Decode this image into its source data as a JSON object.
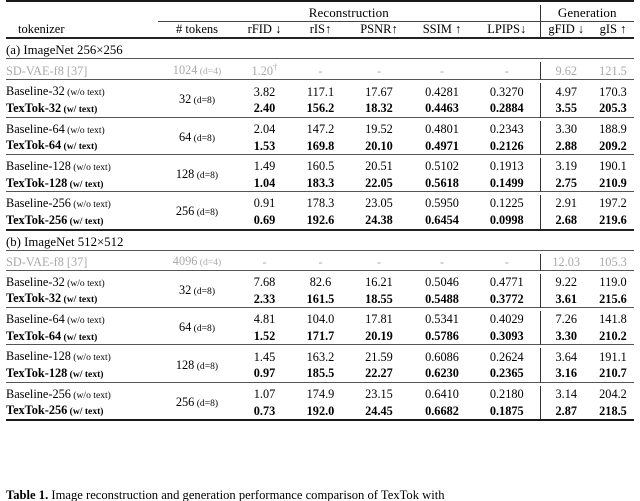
{
  "table": {
    "group_headers": [
      {
        "label": "Reconstruction",
        "span": 6
      },
      {
        "label": "Generation",
        "span": 2
      }
    ],
    "columns": [
      {
        "key": "tokenizer",
        "label": "tokenizer"
      },
      {
        "key": "tokens",
        "label": "# tokens"
      },
      {
        "key": "rfid",
        "label": "rFID ↓"
      },
      {
        "key": "ris",
        "label": "rIS↑"
      },
      {
        "key": "psnr",
        "label": "PSNR↑"
      },
      {
        "key": "ssim",
        "label": "SSIM ↑"
      },
      {
        "key": "lpips",
        "label": "LPIPS↓"
      },
      {
        "key": "gfid",
        "label": "gFID ↓"
      },
      {
        "key": "gis",
        "label": "gIS ↑"
      }
    ],
    "sections": [
      {
        "title": "(a) ImageNet 256×256",
        "baseline_row": {
          "name": "SD-VAE-f8 [37]",
          "tokens": "1024",
          "tokens_dim": "(d=4)",
          "rfid": "1.20",
          "rfid_dagger": true,
          "ris": "-",
          "psnr": "-",
          "ssim": "-",
          "lpips": "-",
          "gfid": "9.62",
          "gis": "121.5"
        },
        "groups": [
          {
            "tokens": "32",
            "tokens_dim": "(d=8)",
            "rows": [
              {
                "name": "Baseline-32",
                "note": "(w/o text)",
                "bold": false,
                "rfid": "3.82",
                "ris": "117.1",
                "psnr": "17.67",
                "ssim": "0.4281",
                "lpips": "0.3270",
                "gfid": "4.97",
                "gis": "170.3"
              },
              {
                "name": "TexTok-32",
                "note": "(w/ text)",
                "bold": true,
                "rfid": "2.40",
                "ris": "156.2",
                "psnr": "18.32",
                "ssim": "0.4463",
                "lpips": "0.2884",
                "gfid": "3.55",
                "gis": "205.3"
              }
            ]
          },
          {
            "tokens": "64",
            "tokens_dim": "(d=8)",
            "rows": [
              {
                "name": "Baseline-64",
                "note": "(w/o text)",
                "bold": false,
                "rfid": "2.04",
                "ris": "147.2",
                "psnr": "19.52",
                "ssim": "0.4801",
                "lpips": "0.2343",
                "gfid": "3.30",
                "gis": "188.9"
              },
              {
                "name": "TexTok-64",
                "note": "(w/ text)",
                "bold": true,
                "rfid": "1.53",
                "ris": "169.8",
                "psnr": "20.10",
                "ssim": "0.4971",
                "lpips": "0.2126",
                "gfid": "2.88",
                "gis": "209.2"
              }
            ]
          },
          {
            "tokens": "128",
            "tokens_dim": "(d=8)",
            "rows": [
              {
                "name": "Baseline-128",
                "note": "(w/o text)",
                "bold": false,
                "rfid": "1.49",
                "ris": "160.5",
                "psnr": "20.51",
                "ssim": "0.5102",
                "lpips": "0.1913",
                "gfid": "3.19",
                "gis": "190.1"
              },
              {
                "name": "TexTok-128",
                "note": "(w/ text)",
                "bold": true,
                "rfid": "1.04",
                "ris": "183.3",
                "psnr": "22.05",
                "ssim": "0.5618",
                "lpips": "0.1499",
                "gfid": "2.75",
                "gis": "210.9"
              }
            ]
          },
          {
            "tokens": "256",
            "tokens_dim": "(d=8)",
            "rows": [
              {
                "name": "Baseline-256",
                "note": "(w/o text)",
                "bold": false,
                "rfid": "0.91",
                "ris": "178.3",
                "psnr": "23.05",
                "ssim": "0.5950",
                "lpips": "0.1225",
                "gfid": "2.91",
                "gis": "197.2"
              },
              {
                "name": "TexTok-256",
                "note": "(w/ text)",
                "bold": true,
                "rfid": "0.69",
                "ris": "192.6",
                "psnr": "24.38",
                "ssim": "0.6454",
                "lpips": "0.0998",
                "gfid": "2.68",
                "gis": "219.6"
              }
            ]
          }
        ]
      },
      {
        "title": "(b) ImageNet 512×512",
        "baseline_row": {
          "name": "SD-VAE-f8 [37]",
          "tokens": "4096",
          "tokens_dim": "(d=4)",
          "rfid": "-",
          "rfid_dagger": false,
          "ris": "-",
          "psnr": "-",
          "ssim": "-",
          "lpips": "-",
          "gfid": "12.03",
          "gis": "105.3"
        },
        "groups": [
          {
            "tokens": "32",
            "tokens_dim": "(d=8)",
            "rows": [
              {
                "name": "Baseline-32",
                "note": "(w/o text)",
                "bold": false,
                "rfid": "7.68",
                "ris": "82.6",
                "psnr": "16.21",
                "ssim": "0.5046",
                "lpips": "0.4771",
                "gfid": "9.22",
                "gis": "119.0"
              },
              {
                "name": "TexTok-32",
                "note": "(w/ text)",
                "bold": true,
                "rfid": "2.33",
                "ris": "161.5",
                "psnr": "18.55",
                "ssim": "0.5488",
                "lpips": "0.3772",
                "gfid": "3.61",
                "gis": "215.6"
              }
            ]
          },
          {
            "tokens": "64",
            "tokens_dim": "(d=8)",
            "rows": [
              {
                "name": "Baseline-64",
                "note": "(w/o text)",
                "bold": false,
                "rfid": "4.81",
                "ris": "104.0",
                "psnr": "17.81",
                "ssim": "0.5341",
                "lpips": "0.4029",
                "gfid": "7.26",
                "gis": "141.8"
              },
              {
                "name": "TexTok-64",
                "note": "(w/ text)",
                "bold": true,
                "rfid": "1.52",
                "ris": "171.7",
                "psnr": "20.19",
                "ssim": "0.5786",
                "lpips": "0.3093",
                "gfid": "3.30",
                "gis": "210.2"
              }
            ]
          },
          {
            "tokens": "128",
            "tokens_dim": "(d=8)",
            "rows": [
              {
                "name": "Baseline-128",
                "note": "(w/o text)",
                "bold": false,
                "rfid": "1.45",
                "ris": "163.2",
                "psnr": "21.59",
                "ssim": "0.6086",
                "lpips": "0.2624",
                "gfid": "3.64",
                "gis": "191.1"
              },
              {
                "name": "TexTok-128",
                "note": "(w/ text)",
                "bold": true,
                "rfid": "0.97",
                "ris": "185.5",
                "psnr": "22.27",
                "ssim": "0.6230",
                "lpips": "0.2365",
                "gfid": "3.16",
                "gis": "210.7"
              }
            ]
          },
          {
            "tokens": "256",
            "tokens_dim": "(d=8)",
            "rows": [
              {
                "name": "Baseline-256",
                "note": "(w/o text)",
                "bold": false,
                "rfid": "1.07",
                "ris": "174.9",
                "psnr": "23.15",
                "ssim": "0.6410",
                "lpips": "0.2180",
                "gfid": "3.14",
                "gis": "204.2"
              },
              {
                "name": "TexTok-256",
                "note": "(w/ text)",
                "bold": true,
                "rfid": "0.73",
                "ris": "192.0",
                "psnr": "24.45",
                "ssim": "0.6682",
                "lpips": "0.1875",
                "gfid": "2.87",
                "gis": "218.5"
              }
            ]
          }
        ]
      }
    ]
  },
  "caption": {
    "label": "Table 1.",
    "text": "Image reconstruction and generation performance comparison of TexTok with"
  }
}
